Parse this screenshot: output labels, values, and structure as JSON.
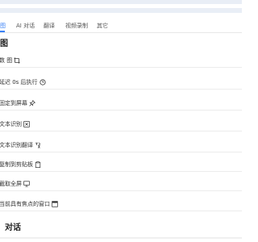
{
  "tabs": [
    {
      "label": "图",
      "active": true
    },
    {
      "label": "AI 对话",
      "active": false
    },
    {
      "label": "翻译",
      "active": false
    },
    {
      "label": "视频录制",
      "active": false
    },
    {
      "label": "其它",
      "active": false
    }
  ],
  "sections": {
    "screenshot_title": "图",
    "ai_title": "对话"
  },
  "menu_items": [
    {
      "label": "数 图",
      "icon": "crop-icon"
    },
    {
      "label": "延迟 0s 后执行",
      "icon": "timer-icon"
    },
    {
      "label": "固定到屏幕",
      "icon": "pin-icon"
    },
    {
      "label": "文本识别",
      "icon": "text-scan-icon"
    },
    {
      "label": "文本识别翻译",
      "icon": "translate-scan-icon"
    },
    {
      "label": "复制到剪贴板",
      "icon": "clipboard-icon"
    },
    {
      "label": "截取全屏",
      "icon": "monitor-icon"
    },
    {
      "label": "当前具有焦点的窗口",
      "icon": "window-icon"
    }
  ],
  "colors": {
    "accent": "#3b82f6",
    "top_strip": "#e9eef6",
    "divider": "#ececec"
  }
}
